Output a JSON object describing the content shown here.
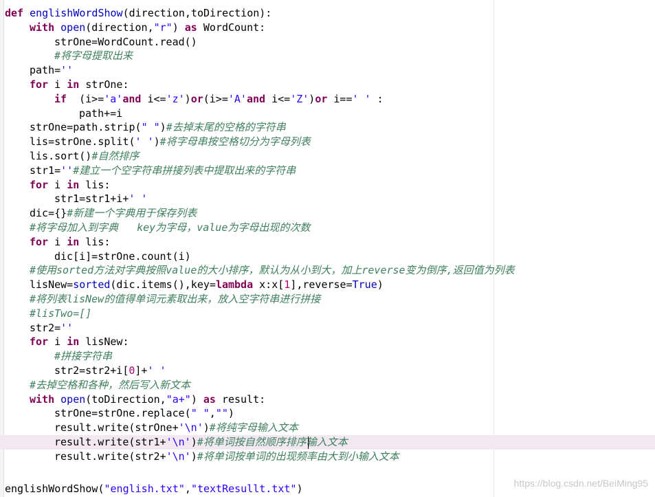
{
  "colors": {
    "keyword": "#7f0055",
    "function": "#0000c0",
    "string": "#2a00ff",
    "number": "#b4007a",
    "comment": "#3f7f5f",
    "text": "#000000",
    "current_line": "#f1e8f1"
  },
  "editor": {
    "highlighted_line": 30,
    "lines": [
      {
        "indent": 0,
        "tokens": [
          [
            "kw",
            "def "
          ],
          [
            "fn",
            "englishWordShow"
          ],
          [
            "txt",
            "(direction,toDirection):"
          ]
        ]
      },
      {
        "indent": 1,
        "tokens": [
          [
            "kw",
            "with "
          ],
          [
            "fn",
            "open"
          ],
          [
            "txt",
            "(direction,"
          ],
          [
            "str",
            "\"r\""
          ],
          [
            "txt",
            ") "
          ],
          [
            "kw",
            "as"
          ],
          [
            "txt",
            " WordCount:"
          ]
        ]
      },
      {
        "indent": 2,
        "tokens": [
          [
            "txt",
            "strOne=WordCount.read()"
          ]
        ]
      },
      {
        "indent": 2,
        "tokens": [
          [
            "com",
            "#将字母提取出来"
          ]
        ]
      },
      {
        "indent": 1,
        "tokens": [
          [
            "txt",
            "path="
          ],
          [
            "str",
            "''"
          ]
        ]
      },
      {
        "indent": 1,
        "tokens": [
          [
            "kw",
            "for"
          ],
          [
            "txt",
            " i "
          ],
          [
            "kw",
            "in"
          ],
          [
            "txt",
            " strOne:"
          ]
        ]
      },
      {
        "indent": 2,
        "tokens": [
          [
            "kw",
            "if"
          ],
          [
            "txt",
            "  (i>="
          ],
          [
            "str",
            "'a'"
          ],
          [
            "kw",
            "and"
          ],
          [
            "txt",
            " i<="
          ],
          [
            "str",
            "'z'"
          ],
          [
            "txt",
            ")"
          ],
          [
            "kw",
            "or"
          ],
          [
            "txt",
            "(i>="
          ],
          [
            "str",
            "'A'"
          ],
          [
            "kw",
            "and"
          ],
          [
            "txt",
            " i<="
          ],
          [
            "str",
            "'Z'"
          ],
          [
            "txt",
            ")"
          ],
          [
            "kw",
            "or"
          ],
          [
            "txt",
            " i=="
          ],
          [
            "str",
            "' '"
          ],
          [
            "txt",
            " :"
          ]
        ]
      },
      {
        "indent": 3,
        "tokens": [
          [
            "txt",
            "path+=i"
          ]
        ]
      },
      {
        "indent": 1,
        "tokens": [
          [
            "txt",
            "strOne=path.strip("
          ],
          [
            "str",
            "\" \""
          ],
          [
            "txt",
            ")"
          ],
          [
            "com",
            "#去掉末尾的空格的字符串"
          ]
        ]
      },
      {
        "indent": 1,
        "tokens": [
          [
            "txt",
            "lis=strOne.split("
          ],
          [
            "str",
            "' '"
          ],
          [
            "txt",
            ")"
          ],
          [
            "com",
            "#将字母串按空格切分为字母列表"
          ]
        ]
      },
      {
        "indent": 1,
        "tokens": [
          [
            "txt",
            "lis.sort()"
          ],
          [
            "com",
            "#自然排序"
          ]
        ]
      },
      {
        "indent": 1,
        "tokens": [
          [
            "txt",
            "str1="
          ],
          [
            "str",
            "''"
          ],
          [
            "com",
            "#建立一个空字符串拼接列表中提取出来的字符串"
          ]
        ]
      },
      {
        "indent": 1,
        "tokens": [
          [
            "kw",
            "for"
          ],
          [
            "txt",
            " i "
          ],
          [
            "kw",
            "in"
          ],
          [
            "txt",
            " lis:"
          ]
        ]
      },
      {
        "indent": 2,
        "tokens": [
          [
            "txt",
            "str1=str1+i+"
          ],
          [
            "str",
            "' '"
          ]
        ]
      },
      {
        "indent": 1,
        "tokens": [
          [
            "txt",
            "dic={}"
          ],
          [
            "com",
            "#新建一个字典用于保存列表"
          ]
        ]
      },
      {
        "indent": 1,
        "tokens": [
          [
            "com",
            "#将字母加入到字典   key为字母，value为字母出现的次数"
          ]
        ]
      },
      {
        "indent": 1,
        "tokens": [
          [
            "kw",
            "for"
          ],
          [
            "txt",
            " i "
          ],
          [
            "kw",
            "in"
          ],
          [
            "txt",
            " lis:"
          ]
        ]
      },
      {
        "indent": 2,
        "tokens": [
          [
            "txt",
            "dic[i]=strOne.count(i)"
          ]
        ]
      },
      {
        "indent": 1,
        "tokens": [
          [
            "com",
            "#使用sorted方法对字典按照value的大小排序，默认为从小到大，加上reverse变为倒序,返回值为列表"
          ]
        ]
      },
      {
        "indent": 1,
        "tokens": [
          [
            "txt",
            "lisNew="
          ],
          [
            "fn",
            "sorted"
          ],
          [
            "txt",
            "(dic.items(),key="
          ],
          [
            "kw",
            "lambda"
          ],
          [
            "txt",
            " x:x["
          ],
          [
            "num",
            "1"
          ],
          [
            "txt",
            "],reverse="
          ],
          [
            "fn",
            "True"
          ],
          [
            "txt",
            ")"
          ]
        ]
      },
      {
        "indent": 1,
        "tokens": [
          [
            "com",
            "#将列表lisNew的值得单词元素取出来，放入空字符串进行拼接"
          ]
        ]
      },
      {
        "indent": 1,
        "tokens": [
          [
            "com",
            "#lisTwo=[]"
          ]
        ]
      },
      {
        "indent": 1,
        "tokens": [
          [
            "txt",
            "str2="
          ],
          [
            "str",
            "''"
          ]
        ]
      },
      {
        "indent": 1,
        "tokens": [
          [
            "kw",
            "for"
          ],
          [
            "txt",
            " i "
          ],
          [
            "kw",
            "in"
          ],
          [
            "txt",
            " lisNew:"
          ]
        ]
      },
      {
        "indent": 2,
        "tokens": [
          [
            "com",
            "#拼接字符串"
          ]
        ]
      },
      {
        "indent": 2,
        "tokens": [
          [
            "txt",
            "str2=str2+i["
          ],
          [
            "num",
            "0"
          ],
          [
            "txt",
            "]+"
          ],
          [
            "str",
            "' '"
          ]
        ]
      },
      {
        "indent": 1,
        "tokens": [
          [
            "com",
            "#去掉空格和各种，然后写入新文本"
          ]
        ]
      },
      {
        "indent": 1,
        "tokens": [
          [
            "kw",
            "with "
          ],
          [
            "fn",
            "open"
          ],
          [
            "txt",
            "(toDirection,"
          ],
          [
            "str",
            "\"a+\""
          ],
          [
            "txt",
            ") "
          ],
          [
            "kw",
            "as"
          ],
          [
            "txt",
            " result:"
          ]
        ]
      },
      {
        "indent": 2,
        "tokens": [
          [
            "txt",
            "strOne=strOne.replace("
          ],
          [
            "str",
            "\" \""
          ],
          [
            "txt",
            ","
          ],
          [
            "str",
            "\"\""
          ],
          [
            "txt",
            ")"
          ]
        ]
      },
      {
        "indent": 2,
        "tokens": [
          [
            "txt",
            "result.write(strOne+"
          ],
          [
            "str",
            "'\\n'"
          ],
          [
            "txt",
            ")"
          ],
          [
            "com",
            "#将纯字母输入文本"
          ]
        ]
      },
      {
        "indent": 2,
        "tokens": [
          [
            "txt",
            "result.write(str1+"
          ],
          [
            "str",
            "'\\n'"
          ],
          [
            "txt",
            ")"
          ],
          [
            "com",
            "#将单词按自然顺序排序输入文本"
          ]
        ]
      },
      {
        "indent": 2,
        "tokens": [
          [
            "txt",
            "result.write(str2+"
          ],
          [
            "str",
            "'\\n'"
          ],
          [
            "txt",
            ")"
          ],
          [
            "com",
            "#将单词按单词的出现频率由大到小输入文本"
          ]
        ]
      },
      {
        "indent": 0,
        "tokens": []
      },
      {
        "indent": 0,
        "tokens": [
          [
            "txt",
            "englishWordShow("
          ],
          [
            "str",
            "\"english.txt\""
          ],
          [
            "txt",
            ","
          ],
          [
            "str",
            "\"textResullt.txt\""
          ],
          [
            "txt",
            ")"
          ]
        ]
      }
    ]
  },
  "watermark": "https://blog.csdn.net/BeiMing95"
}
